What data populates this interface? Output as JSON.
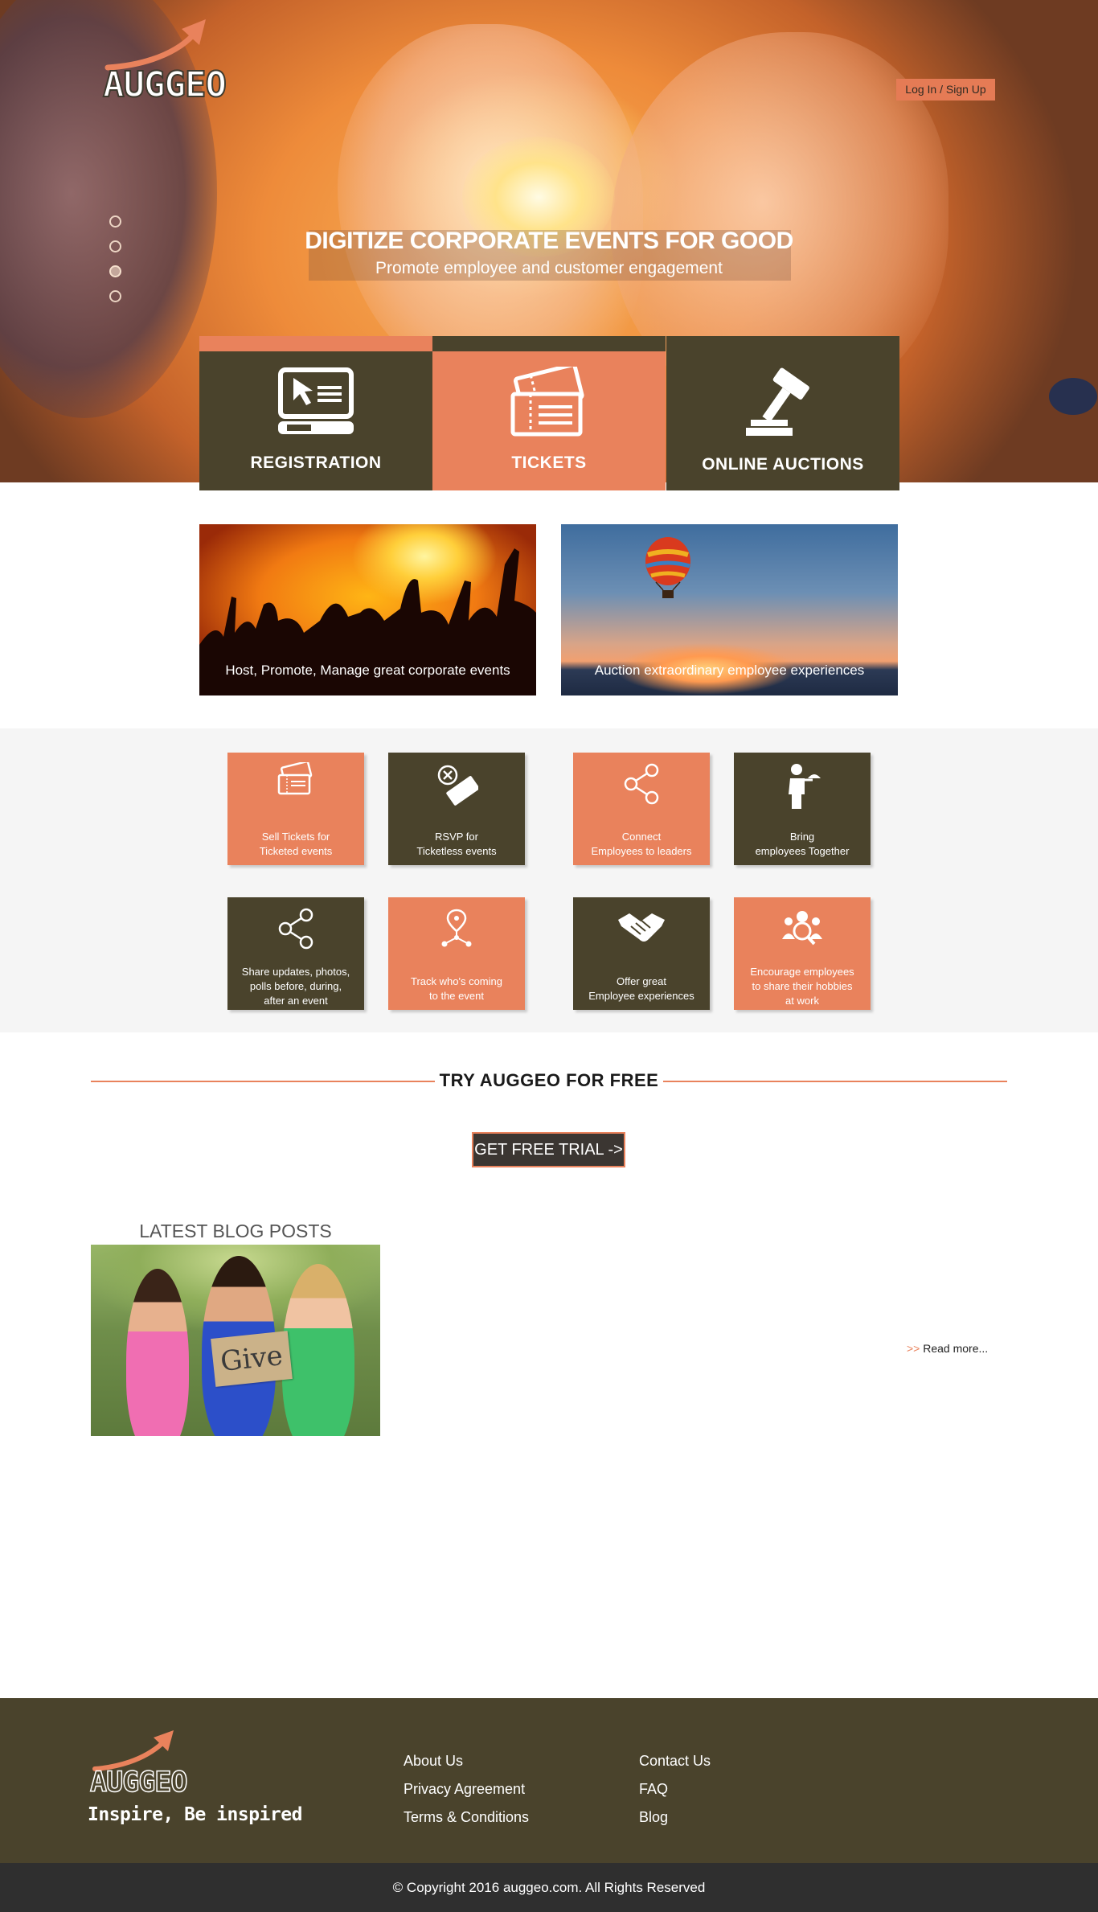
{
  "header": {
    "logo_text": "AUGGEO",
    "login_label": "Log In / Sign Up"
  },
  "hero": {
    "title": "DIGITIZE CORPORATE EVENTS FOR GOOD",
    "subtitle": "Promote employee and customer engagement",
    "slides": 4,
    "active_slide": 3
  },
  "features": [
    {
      "label": "REGISTRATION",
      "icon": "computer-icon"
    },
    {
      "label": "TICKETS",
      "icon": "ticket-icon"
    },
    {
      "label": "ONLINE AUCTIONS",
      "icon": "gavel-icon"
    }
  ],
  "promos": [
    {
      "caption": "Host, Promote, Manage great corporate events"
    },
    {
      "caption": "Auction extraordinary employee experiences"
    }
  ],
  "services": [
    {
      "line1": "Sell Tickets for",
      "line2": "Ticketed events",
      "icon": "ticket-icon"
    },
    {
      "line1": "RSVP for",
      "line2": "Ticketless events",
      "icon": "rsvp-icon"
    },
    {
      "line1": "Connect",
      "line2": "Employees to leaders",
      "icon": "share-icon"
    },
    {
      "line1": "Bring",
      "line2": "employees Together",
      "icon": "waiter-icon"
    },
    {
      "line1": "Share updates, photos,",
      "line2": "polls before, during,",
      "line3": "after an event",
      "icon": "share-icon"
    },
    {
      "line1": "Track who's coming",
      "line2": "to the event",
      "icon": "location-network-icon"
    },
    {
      "line1": "Offer great",
      "line2": "Employee experiences",
      "icon": "handshake-icon"
    },
    {
      "line1": "Encourage employees",
      "line2": "to share their hobbies",
      "line3": "at work",
      "icon": "people-search-icon"
    }
  ],
  "try": {
    "title": "TRY AUGGEO FOR FREE",
    "button_label": "GET FREE TRIAL ->"
  },
  "blog": {
    "title": "LATEST BLOG POSTS",
    "sign_text": "Give",
    "read_more_arrow": ">>",
    "read_more_label": "Read more..."
  },
  "footer": {
    "logo_text": "AUGGEO",
    "tagline": "Inspire, Be inspired",
    "col1": [
      "About Us",
      "Privacy Agreement",
      "Terms & Conditions"
    ],
    "col2": [
      "Contact Us",
      "FAQ",
      "Blog"
    ],
    "copyright": "© Copyright 2016 auggeo.com. All Rights Reserved"
  },
  "colors": {
    "accent_orange": "#e9825c",
    "dark_olive": "#4a432c",
    "footer_bottom": "#2f2f2f"
  }
}
